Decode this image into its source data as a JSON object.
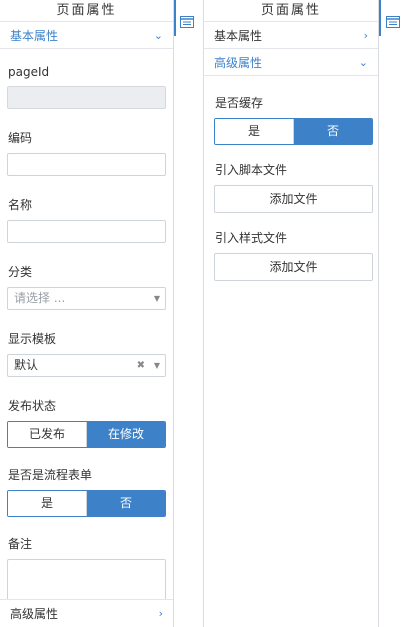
{
  "left_panel": {
    "title": "页面属性",
    "section_header": "基本属性",
    "fields": {
      "page_id_label": "pageId",
      "code_label": "编码",
      "name_label": "名称",
      "category_label": "分类",
      "category_placeholder": "请选择 ...",
      "template_label": "显示模板",
      "template_value": "默认",
      "publish_label": "发布状态",
      "publish_options": [
        "已发布",
        "在修改"
      ],
      "publish_selected": "在修改",
      "flow_label": "是否是流程表单",
      "flow_options": [
        "是",
        "否"
      ],
      "flow_selected": "否",
      "remark_label": "备注"
    },
    "bottom_section": "高级属性"
  },
  "right_panel": {
    "title": "页面属性",
    "basic_section": "基本属性",
    "advanced_section": "高级属性",
    "cache_label": "是否缓存",
    "cache_options": [
      "是",
      "否"
    ],
    "cache_selected": "否",
    "script_label": "引入脚本文件",
    "script_button": "添加文件",
    "style_label": "引入样式文件",
    "style_button": "添加文件"
  },
  "colors": {
    "accent": "#3d82c9",
    "border": "#cfd4da",
    "disabled_bg": "#ebedf0"
  },
  "icons": {
    "side_toggle": "properties-panel-icon",
    "chevron_down": "chevron-down-icon",
    "chevron_right": "chevron-right-icon"
  }
}
